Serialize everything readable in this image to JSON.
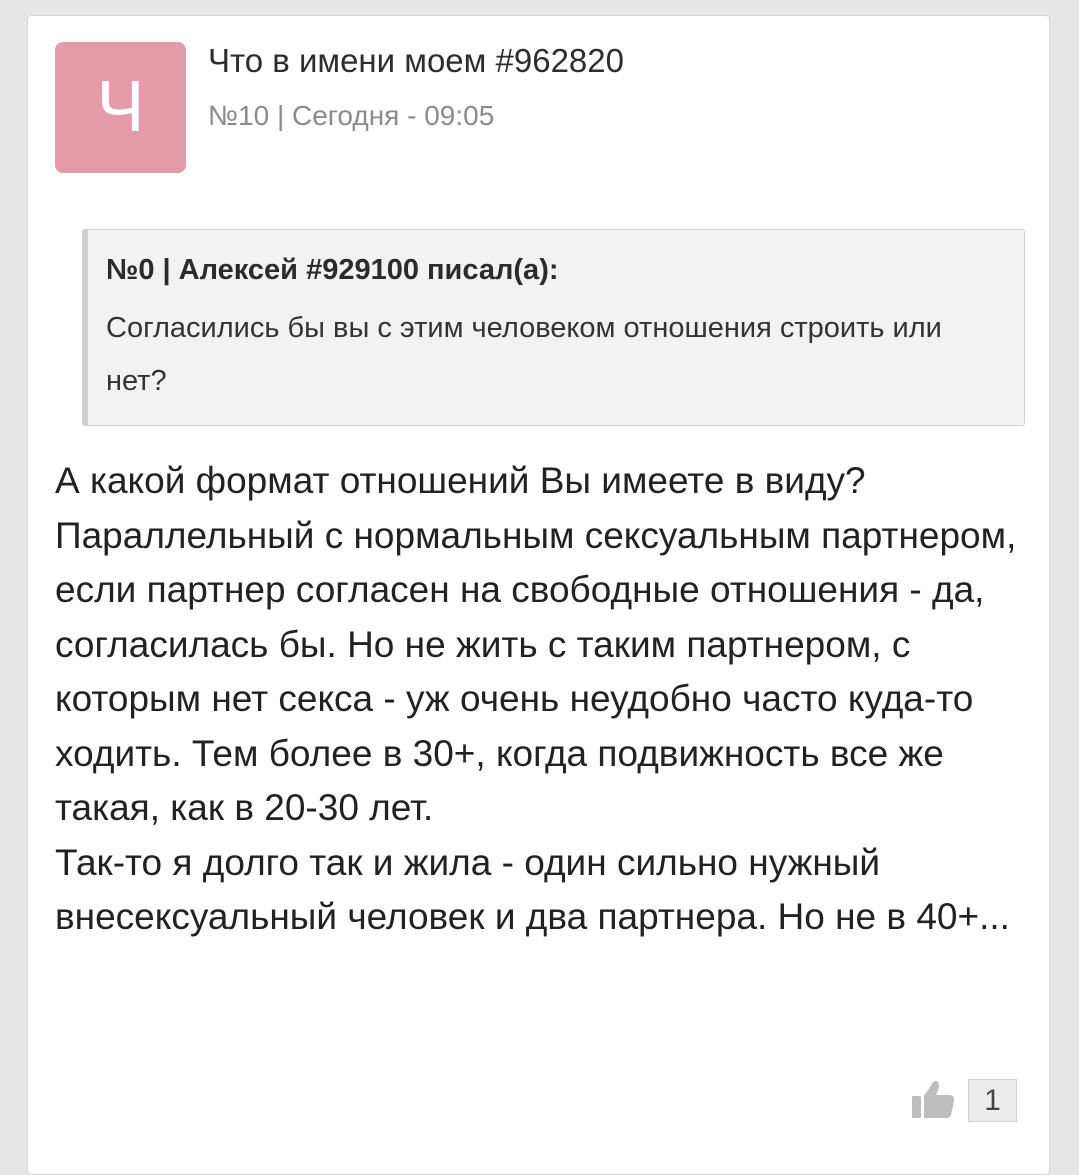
{
  "post": {
    "avatar_letter": "Ч",
    "author": "Что в имени моем #962820",
    "meta": "№10 | Сегодня - 09:05",
    "quote": {
      "header": "№0 | Алексей #929100 писал(а):",
      "text": "Согласились бы вы с этим человеком отношения строить или нет?"
    },
    "body_paragraphs": [
      "А какой формат отношений Вы имеете в виду? Параллельный с нормальным сексуальным партнером, если партнер согласен на свободные отношения - да, согласилась бы. Но не жить с таким партнером, с которым нет секса - уж очень неудобно часто куда-то ходить. Тем более в 30+, когда подвижность все же такая, как в 20-30 лет.",
      "Так-то я долго так и жила - один сильно нужный внесексуальный человек и два партнера. Но не в 40+..."
    ],
    "likes": "1"
  },
  "icons": {
    "like": "thumbs-up-icon"
  },
  "colors": {
    "avatar_bg": "#e49aa9",
    "background": "#e6e6e6",
    "card": "#ffffff",
    "quote_bg": "#f2f2f2"
  }
}
